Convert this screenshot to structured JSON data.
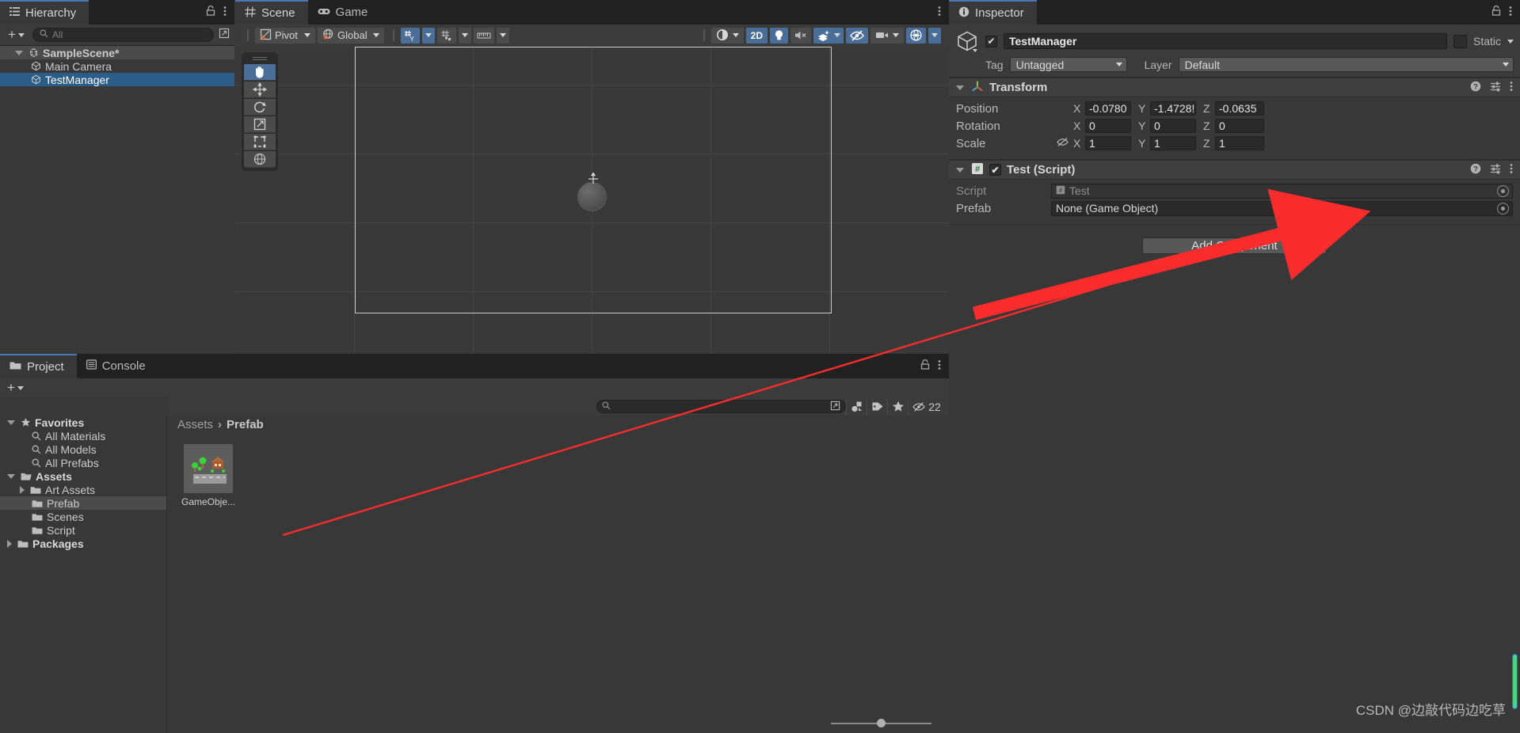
{
  "hierarchy": {
    "tab_label": "Hierarchy",
    "tab_icon": "hierarchy-icon",
    "search_placeholder": "All",
    "add_label": "+",
    "items": [
      {
        "label": "SampleScene*",
        "icon": "unity-scene-icon",
        "depth": 0,
        "state": "scene"
      },
      {
        "label": "Main Camera",
        "icon": "gameobject-icon",
        "depth": 1,
        "state": "normal"
      },
      {
        "label": "TestManager",
        "icon": "gameobject-icon",
        "depth": 1,
        "state": "selected"
      }
    ]
  },
  "scene": {
    "tabs": [
      {
        "label": "Scene",
        "icon": "scene-grid-icon",
        "active": true
      },
      {
        "label": "Game",
        "icon": "gamepad-icon",
        "active": false
      }
    ],
    "toolbar": {
      "pivot_label": "Pivot",
      "handle_label": "Global",
      "grid_label": "grid-axis-y",
      "snap_label": "grid-snap-icon",
      "ruler_label": "ruler-icon",
      "shading_label": "shading-mode-icon",
      "two_d_label": "2D",
      "lighting_label": "light-icon",
      "audio_label": "audio-mute-icon",
      "fx_label": "effects-icon",
      "hidden_label": "visibility-off-icon",
      "camera_label": "camera-icon",
      "gizmos_label": "gizmos-icon"
    },
    "tools": [
      {
        "name": "hand-tool",
        "glyph": "✋",
        "active": true
      },
      {
        "name": "move-tool",
        "glyph": "move",
        "active": false
      },
      {
        "name": "rotate-tool",
        "glyph": "rotate",
        "active": false
      },
      {
        "name": "scale-tool",
        "glyph": "scale",
        "active": false
      },
      {
        "name": "rect-tool",
        "glyph": "rect",
        "active": false
      },
      {
        "name": "transform-tool",
        "glyph": "transform",
        "active": false
      }
    ]
  },
  "inspector": {
    "tab_label": "Inspector",
    "tab_icon": "info-icon",
    "object": {
      "enabled": true,
      "name": "TestManager",
      "static_label": "Static",
      "static_checked": false,
      "tag_label": "Tag",
      "tag_value": "Untagged",
      "layer_label": "Layer",
      "layer_value": "Default"
    },
    "components": [
      {
        "title": "Transform",
        "icon": "transform-axis-icon",
        "has_checkbox": false,
        "rows": [
          {
            "label": "Position",
            "fields": [
              {
                "axis": "X",
                "value": "-0.0780"
              },
              {
                "axis": "Y",
                "value": "-1.4728!"
              },
              {
                "axis": "Z",
                "value": "-0.0635"
              }
            ]
          },
          {
            "label": "Rotation",
            "fields": [
              {
                "axis": "X",
                "value": "0"
              },
              {
                "axis": "Y",
                "value": "0"
              },
              {
                "axis": "Z",
                "value": "0"
              }
            ]
          },
          {
            "label": "Scale",
            "link_icon": "scale-unlink-icon",
            "fields": [
              {
                "axis": "X",
                "value": "1"
              },
              {
                "axis": "Y",
                "value": "1"
              },
              {
                "axis": "Z",
                "value": "1"
              }
            ]
          }
        ]
      },
      {
        "title": "Test (Script)",
        "icon": "cs-script-icon",
        "has_checkbox": true,
        "checked": true,
        "object_rows": [
          {
            "label": "Script",
            "value": "Test",
            "icon": "cs-script-icon",
            "dim": true
          },
          {
            "label": "Prefab",
            "value": "None (Game Object)",
            "icon": "",
            "dim": false
          }
        ]
      }
    ],
    "add_component_label": "Add Component"
  },
  "project": {
    "tabs": [
      {
        "label": "Project",
        "icon": "folder-icon",
        "active": true
      },
      {
        "label": "Console",
        "icon": "console-icon",
        "active": false
      }
    ],
    "add_label": "+",
    "search_placeholder": "",
    "hidden_count": "22",
    "breadcrumbs": [
      {
        "label": "Assets",
        "dim": true
      },
      {
        "label": "Prefab",
        "dim": false
      }
    ],
    "tree": [
      {
        "label": "Favorites",
        "icon": "star-icon",
        "depth": 0,
        "bold": true,
        "expanded": true
      },
      {
        "label": "All Materials",
        "icon": "search-icon",
        "depth": 1,
        "bold": false
      },
      {
        "label": "All Models",
        "icon": "search-icon",
        "depth": 1,
        "bold": false
      },
      {
        "label": "All Prefabs",
        "icon": "search-icon",
        "depth": 1,
        "bold": false
      },
      {
        "label": "Assets",
        "icon": "folder-open-icon",
        "depth": 0,
        "bold": true,
        "expanded": true
      },
      {
        "label": "Art Assets",
        "icon": "folder-icon",
        "depth": 1,
        "bold": false,
        "collapsed": true
      },
      {
        "label": "Prefab",
        "icon": "folder-icon",
        "depth": 1,
        "bold": false,
        "selected": true
      },
      {
        "label": "Scenes",
        "icon": "folder-icon",
        "depth": 1,
        "bold": false
      },
      {
        "label": "Script",
        "icon": "folder-icon",
        "depth": 1,
        "bold": false
      },
      {
        "label": "Packages",
        "icon": "folder-icon",
        "depth": 0,
        "bold": true,
        "collapsed": true
      }
    ],
    "assets": [
      {
        "name": "GameObje...",
        "type": "prefab-thumbnail"
      }
    ],
    "zoom_slider": 0.5
  },
  "annotation": {
    "arrow_color": "#fb2c2c",
    "description": "red-arrow-pointing-to-prefab-field"
  },
  "watermark": {
    "text": "CSDN @边敲代码边吃草"
  },
  "colors": {
    "accent_blue": "#4a6e98",
    "selection_blue": "#2c5d87",
    "panel_bg": "#383838",
    "tabbar_bg": "#212121",
    "toolbar_bg": "#3b3b3b",
    "field_bg": "#2a2a2a"
  }
}
